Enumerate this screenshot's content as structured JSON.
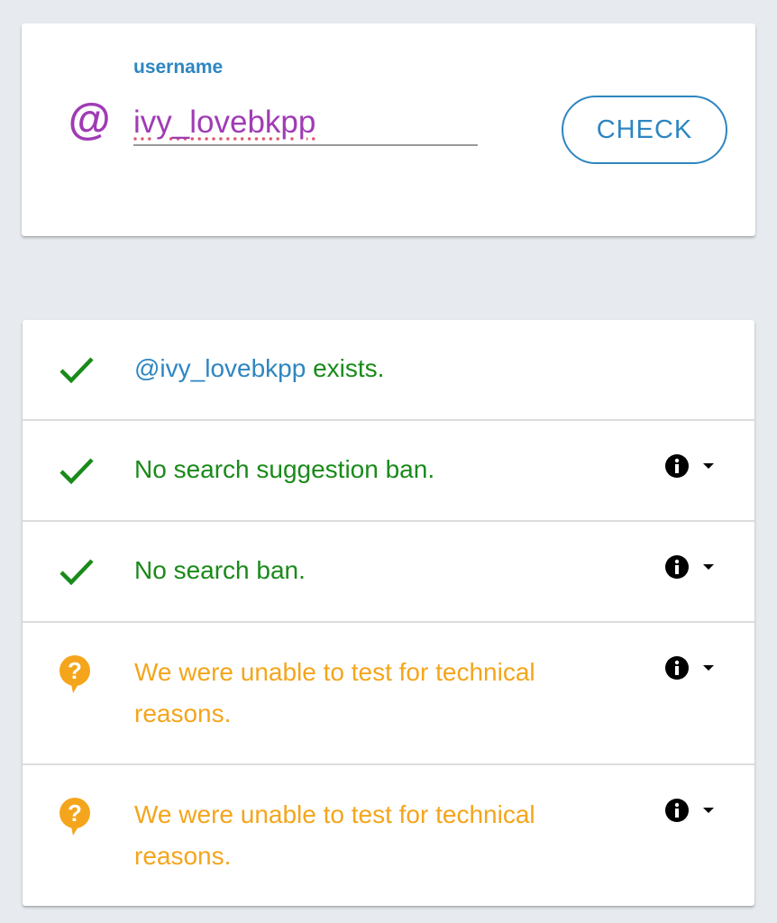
{
  "search": {
    "label": "username",
    "at_symbol": "@",
    "value": "ivy_lovebkpp",
    "button_label": "CHECK"
  },
  "results": [
    {
      "status": "ok",
      "icon": "check-icon",
      "handle": "@ivy_lovebkpp",
      "text": " exists.",
      "has_info": false
    },
    {
      "status": "ok",
      "icon": "check-icon",
      "text": "No search suggestion ban.",
      "has_info": true
    },
    {
      "status": "ok",
      "icon": "check-icon",
      "text": "No search ban.",
      "has_info": true
    },
    {
      "status": "unknown",
      "icon": "question-bubble-icon",
      "text": "We were unable to test for technical reasons.",
      "has_info": true
    },
    {
      "status": "unknown",
      "icon": "question-bubble-icon",
      "text": "We were unable to test for technical reasons.",
      "has_info": true
    }
  ],
  "colors": {
    "accent": "#2e86c1",
    "username": "#a03bb4",
    "ok": "#1a8a1a",
    "warn": "#f4a51c",
    "background": "#e7ebef"
  }
}
